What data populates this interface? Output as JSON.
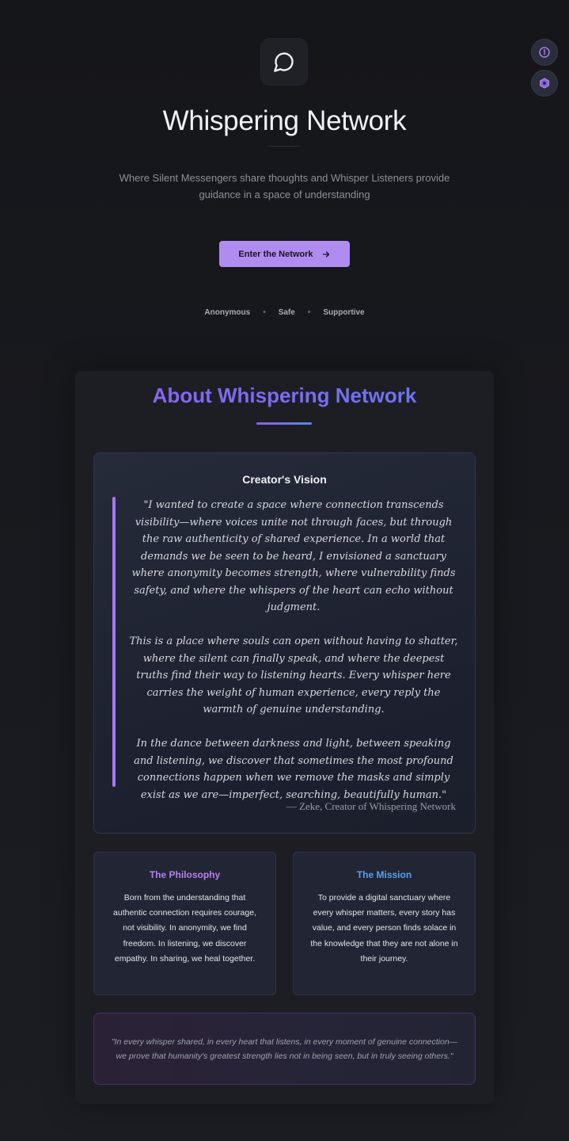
{
  "floating": {
    "info_icon": "info-icon",
    "settings_icon": "hexagon-settings-icon"
  },
  "hero": {
    "logo_icon": "message-circle-icon",
    "title": "Whispering Network",
    "subtitle": "Where Silent Messengers share thoughts and Whisper Listeners provide guidance in a space of understanding",
    "enter_button": "Enter the Network",
    "enter_icon": "arrow-right-icon",
    "tags": [
      "Anonymous",
      "Safe",
      "Supportive"
    ],
    "tag_separator": "•"
  },
  "about": {
    "title": "About Whispering Network",
    "vision": {
      "title": "Creator's Vision",
      "paragraphs": [
        "\"I wanted to create a space where connection transcends visibility—where voices unite not through faces, but through the raw authenticity of shared experience. In a world that demands we be seen to be heard, I envisioned a sanctuary where anonymity becomes strength, where vulnerability finds safety, and where the whispers of the heart can echo without judgment.",
        "This is a place where souls can open without having to shatter, where the silent can finally speak, and where the deepest truths find their way to listening hearts. Every whisper here carries the weight of human experience, every reply the warmth of genuine understanding.",
        "In the dance between darkness and light, between speaking and listening, we discover that sometimes the most profound connections happen when we remove the masks and simply exist as we are—imperfect, searching, beautifully human.\""
      ],
      "signature": "— Zeke, Creator of Whispering Network"
    },
    "philosophy": {
      "title": "The Philosophy",
      "text": "Born from the understanding that authentic connection requires courage, not visibility. In anonymity, we find freedom. In listening, we discover empathy. In sharing, we heal together."
    },
    "mission": {
      "title": "The Mission",
      "text": "To provide a digital sanctuary where every whisper matters, every story has value, and every person finds solace in the knowledge that they are not alone in their journey."
    },
    "closing_quote": "\"In every whisper shared, in every heart that listens, in every moment of genuine connection— we prove that humanity's greatest strength lies not in being seen, but in truly seeing others.\""
  },
  "colors": {
    "accent": "#b08cf0",
    "gradient_start": "#9a5cf0",
    "gradient_end": "#5c7ee8",
    "philosophy_title": "#b97ef0",
    "mission_title": "#5a9ef0"
  }
}
